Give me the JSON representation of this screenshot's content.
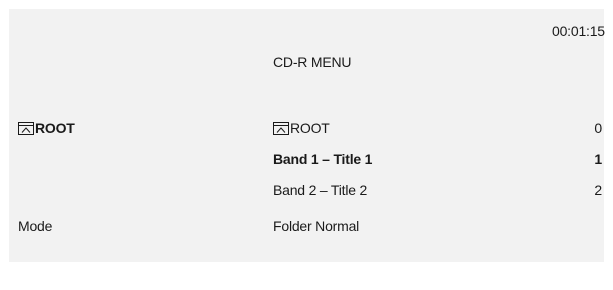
{
  "screen": {
    "time": "00:01:15",
    "title": "CD-R MENU"
  },
  "left_panel": {
    "current_folder": "ROOT",
    "current_folder_icon": "folder-icon",
    "mode_label": "Mode"
  },
  "file_list": {
    "items": [
      {
        "label": "ROOT",
        "icon": "folder-icon",
        "index": "0",
        "selected": false
      },
      {
        "label": "Band 1 – Title 1",
        "icon": null,
        "index": "1",
        "selected": true
      },
      {
        "label": "Band 2 – Title 2",
        "icon": null,
        "index": "2",
        "selected": false
      }
    ]
  },
  "mode": {
    "value": "Folder Normal"
  }
}
